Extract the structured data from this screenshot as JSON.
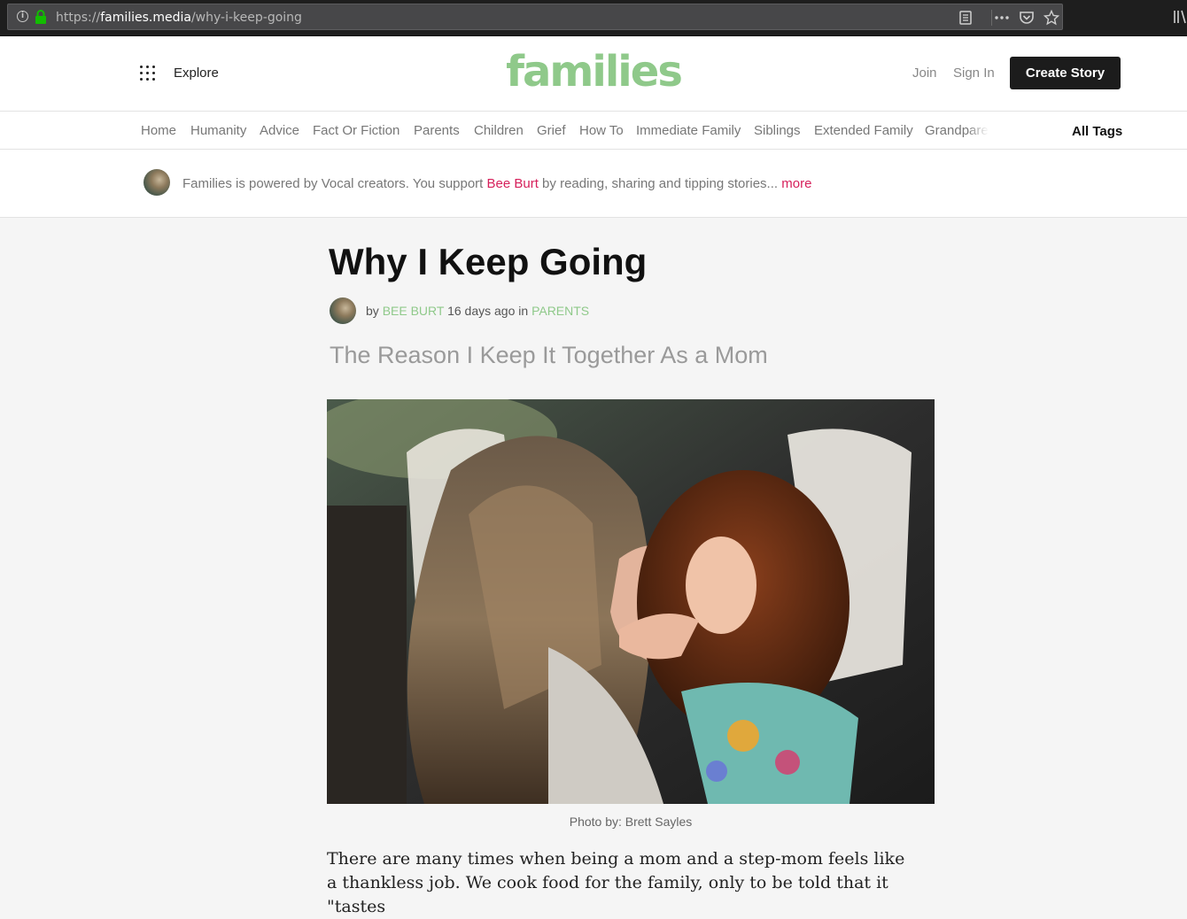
{
  "browser": {
    "url_scheme": "https://",
    "url_host": "families.media",
    "url_path": "/why-i-keep-going"
  },
  "header": {
    "explore_label": "Explore",
    "logo": "families",
    "join_label": "Join",
    "signin_label": "Sign In",
    "create_label": "Create Story"
  },
  "tags": {
    "items": [
      "Home",
      "Humanity",
      "Advice",
      "Fact Or Fiction",
      "Parents",
      "Children",
      "Grief",
      "How To",
      "Immediate Family",
      "Siblings",
      "Extended Family",
      "Grandparents"
    ],
    "all_label": "All Tags"
  },
  "banner": {
    "text_before": "Families is powered by Vocal creators. You support ",
    "author": "Bee Burt",
    "text_after": " by reading, sharing and tipping stories... ",
    "more": "more"
  },
  "article": {
    "title": "Why I Keep Going",
    "by": "by ",
    "author": "BEE BURT",
    "time": " 16 days ago in ",
    "category": "PARENTS",
    "subtitle": "The Reason I Keep It Together As a Mom",
    "caption": "Photo by: Brett Sayles",
    "body": "There are many times when being a mom and a step-mom feels like a thankless job. We cook food for the family, only to be told that it \"tastes"
  },
  "colors": {
    "brand_green": "#8fc98a",
    "link_pink": "#d6205b",
    "button_dark": "#1c1c1c"
  }
}
